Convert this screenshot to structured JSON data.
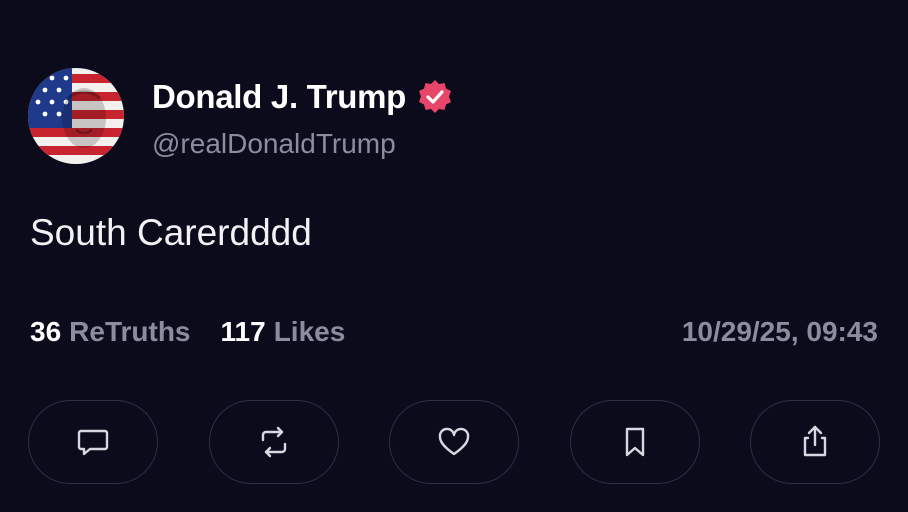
{
  "post": {
    "display_name": "Donald J. Trump",
    "handle": "@realDonaldTrump",
    "text": "South Carerdddd",
    "retruths_count": "36",
    "retruths_label": "ReTruths",
    "likes_count": "117",
    "likes_label": "Likes",
    "timestamp": "10/29/25, 09:43"
  },
  "actions": [
    {
      "icon": "comment-icon"
    },
    {
      "icon": "retruth-icon"
    },
    {
      "icon": "heart-icon"
    },
    {
      "icon": "bookmark-icon"
    },
    {
      "icon": "share-icon"
    }
  ],
  "colors": {
    "background": "#0b0b1c",
    "verified_badge": "#e8456b",
    "muted_text": "#8c8c9e"
  }
}
